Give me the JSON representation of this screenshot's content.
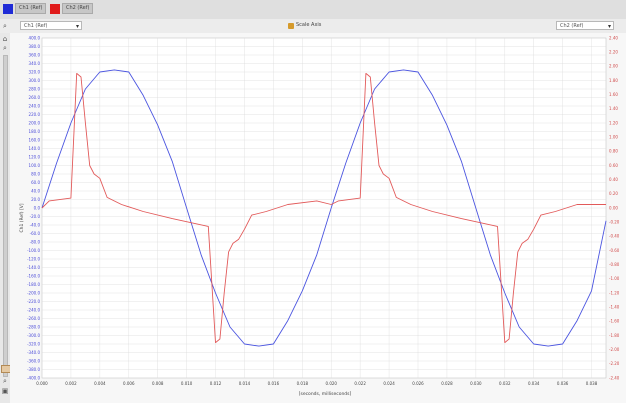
{
  "legend": {
    "ch1_label": "Ch1 (Ref)",
    "ch2_label": "Ch2 (Ref)",
    "ch1_color": "#1f2bd6",
    "ch2_color": "#e01b1b"
  },
  "toolbar": {
    "left_select": "Ch1 (Ref)",
    "center_label": "Scale Axis",
    "right_select": "Ch2 (Ref)"
  },
  "chart_data": {
    "type": "line",
    "xlabel": "[seconds, milliseconds]",
    "ylabel_left": "Ch1 (Ref) [V]",
    "x_ticks": [
      "0.000",
      "0.002",
      "0.004",
      "0.006",
      "0.008",
      "0.010",
      "0.012",
      "0.014",
      "0.016",
      "0.018",
      "0.020",
      "0.022",
      "0.024",
      "0.026",
      "0.028",
      "0.030",
      "0.032",
      "0.034",
      "0.036",
      "0.038"
    ],
    "y_left_ticks": [
      "400.0",
      "380.0",
      "360.0",
      "340.0",
      "320.0",
      "300.0",
      "280.0",
      "260.0",
      "240.0",
      "220.0",
      "200.0",
      "180.0",
      "160.0",
      "140.0",
      "120.0",
      "100.0",
      "80.0",
      "60.0",
      "40.0",
      "20.0",
      "0.0",
      "-20.0",
      "-40.0",
      "-60.0",
      "-80.0",
      "-100.0",
      "-120.0",
      "-140.0",
      "-160.0",
      "-180.0",
      "-200.0",
      "-220.0",
      "-240.0",
      "-260.0",
      "-280.0",
      "-300.0",
      "-320.0",
      "-340.0",
      "-360.0",
      "-380.0",
      "-400.0"
    ],
    "y_right_ticks": [
      "2.40",
      "2.20",
      "2.00",
      "1.80",
      "1.60",
      "1.40",
      "1.20",
      "1.00",
      "0.80",
      "0.60",
      "0.40",
      "0.20",
      "0.00",
      "-0.20",
      "-0.40",
      "-0.60",
      "-0.80",
      "-1.00",
      "-1.20",
      "-1.40",
      "-1.60",
      "-1.80",
      "-2.00",
      "-2.20",
      "-2.40"
    ],
    "xlim": [
      0,
      0.039
    ],
    "ylim_left": [
      -400,
      400
    ],
    "ylim_right": [
      -2.4,
      2.4
    ],
    "grid": true,
    "series": [
      {
        "name": "Ch1 (Ref)",
        "axis": "left",
        "color": "#4b55e0",
        "x": [
          0.0,
          0.001,
          0.002,
          0.003,
          0.004,
          0.005,
          0.006,
          0.007,
          0.008,
          0.009,
          0.01,
          0.011,
          0.012,
          0.013,
          0.014,
          0.015,
          0.016,
          0.017,
          0.018,
          0.019,
          0.02,
          0.021,
          0.022,
          0.023,
          0.024,
          0.025,
          0.026,
          0.027,
          0.028,
          0.029,
          0.03,
          0.031,
          0.032,
          0.033,
          0.034,
          0.035,
          0.036,
          0.037,
          0.038,
          0.039
        ],
        "y": [
          0,
          105,
          200,
          280,
          320,
          325,
          320,
          265,
          195,
          110,
          0,
          -110,
          -200,
          -280,
          -320,
          -325,
          -320,
          -265,
          -195,
          -110,
          0,
          105,
          200,
          280,
          320,
          325,
          320,
          265,
          195,
          110,
          0,
          -110,
          -200,
          -280,
          -320,
          -325,
          -320,
          -265,
          -195,
          -30
        ]
      },
      {
        "name": "Ch2 (Ref)",
        "axis": "right",
        "color": "#e25a5a",
        "x": [
          0.0,
          0.0005,
          0.002,
          0.0024,
          0.0027,
          0.003,
          0.0033,
          0.0036,
          0.004,
          0.0045,
          0.0055,
          0.007,
          0.009,
          0.0115,
          0.012,
          0.0123,
          0.0126,
          0.0129,
          0.0132,
          0.0136,
          0.014,
          0.0145,
          0.0155,
          0.017,
          0.019,
          0.02,
          0.0205,
          0.022,
          0.0224,
          0.0227,
          0.023,
          0.0233,
          0.0236,
          0.024,
          0.0245,
          0.0255,
          0.027,
          0.029,
          0.0315,
          0.032,
          0.0323,
          0.0326,
          0.0329,
          0.0332,
          0.0336,
          0.034,
          0.0345,
          0.0355,
          0.037,
          0.039
        ],
        "y": [
          0.0,
          0.1,
          0.14,
          1.9,
          1.85,
          1.2,
          0.6,
          0.48,
          0.42,
          0.15,
          0.05,
          -0.05,
          -0.15,
          -0.26,
          -1.9,
          -1.85,
          -1.2,
          -0.62,
          -0.5,
          -0.44,
          -0.3,
          -0.1,
          -0.05,
          0.05,
          0.1,
          0.05,
          0.1,
          0.14,
          1.9,
          1.85,
          1.2,
          0.6,
          0.48,
          0.42,
          0.15,
          0.05,
          -0.05,
          -0.15,
          -0.26,
          -1.9,
          -1.85,
          -1.2,
          -0.62,
          -0.5,
          -0.44,
          -0.3,
          -0.1,
          -0.05,
          0.05,
          0.05
        ]
      }
    ]
  }
}
